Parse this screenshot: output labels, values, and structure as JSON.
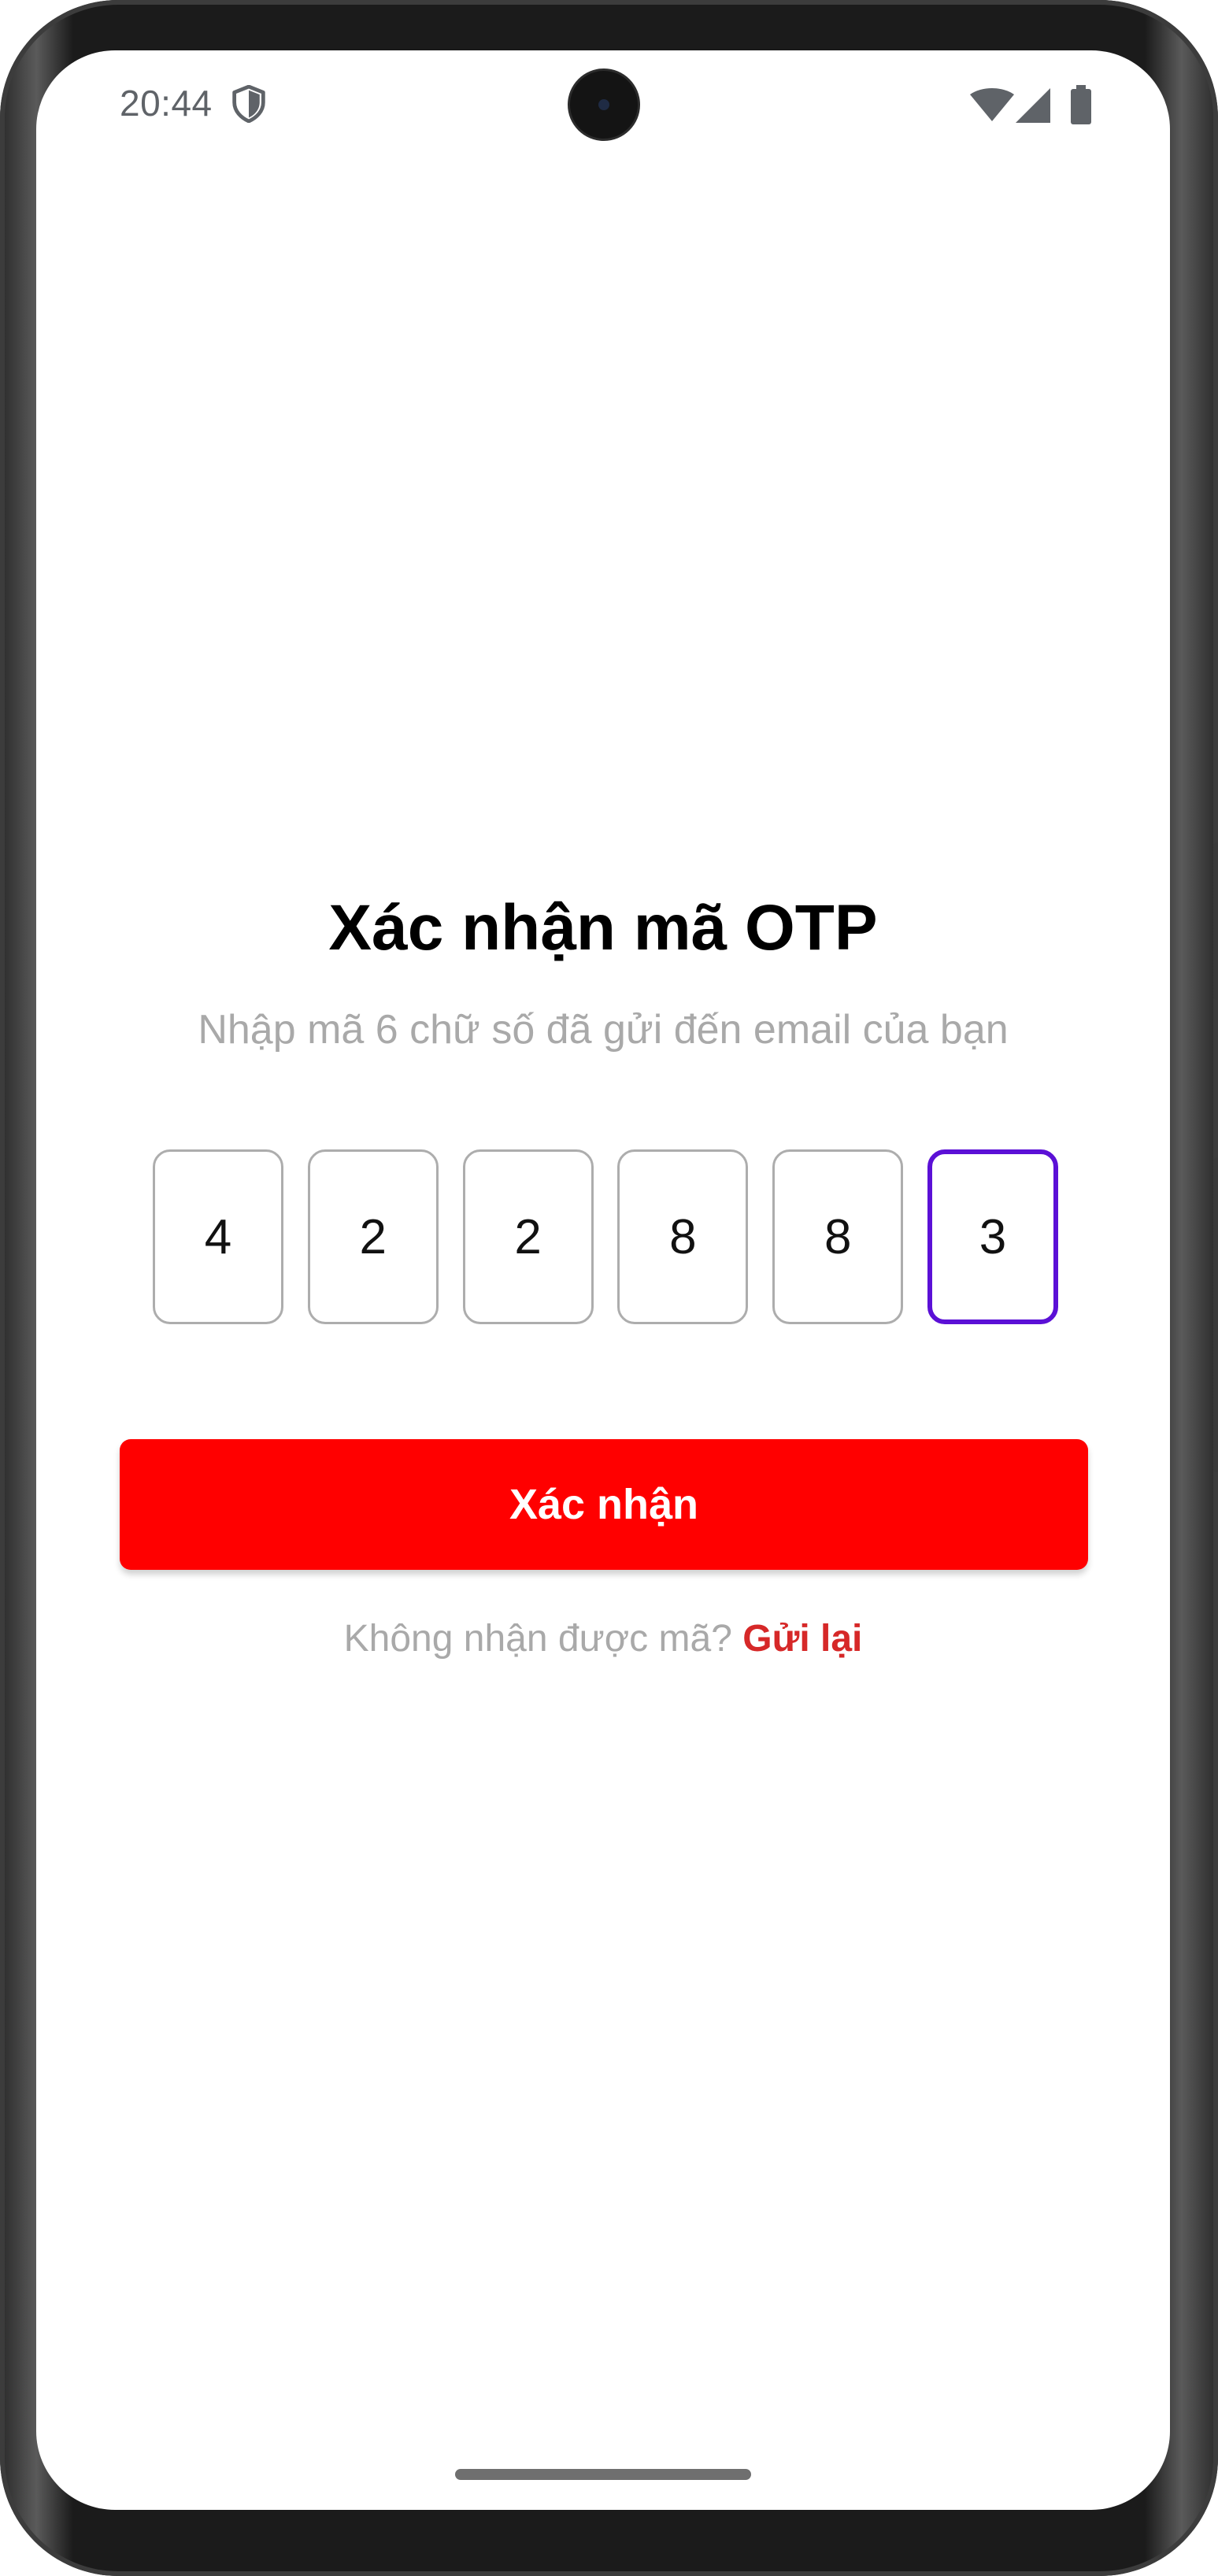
{
  "status_bar": {
    "time": "20:44",
    "icons": [
      "shield-icon",
      "wifi-icon",
      "signal-icon",
      "battery-icon"
    ]
  },
  "otp": {
    "title": "Xác nhận mã OTP",
    "subtitle": "Nhập mã 6 chữ số đã gửi đến email của bạn",
    "digits": [
      "4",
      "2",
      "2",
      "8",
      "8",
      "3"
    ],
    "active_index": 5,
    "confirm_label": "Xác nhận",
    "resend_prompt": "Không nhận được mã?",
    "resend_link": "Gửi lại"
  },
  "colors": {
    "primary_button": "#ff0000",
    "active_border": "#5b10d6",
    "resend_link": "#d62828",
    "muted_text": "#a9a9a9"
  }
}
